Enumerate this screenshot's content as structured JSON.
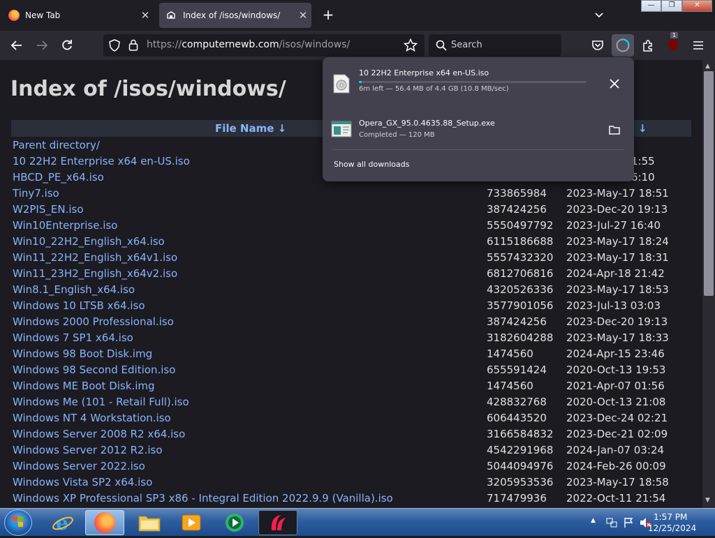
{
  "tabs": [
    {
      "title": "New Tab"
    },
    {
      "title": "Index of /isos/windows/"
    }
  ],
  "navbar": {
    "url_prefix": "https://",
    "url_host": "computernewb.com",
    "url_path": "/isos/windows/",
    "search_placeholder": "Search",
    "extension_badge": "1"
  },
  "page": {
    "title": "Index of /isos/windows/",
    "column_name": "File Name  ↓",
    "column_date_arrow": "↓",
    "parent_link": "Parent directory/",
    "files": [
      {
        "name": "10 22H2 Enterprise x64 en-US.iso",
        "size": "",
        "date": "1:55"
      },
      {
        "name": "HBCD_PE_x64.iso",
        "size": "",
        "date": "6:10"
      },
      {
        "name": "Tiny7.iso",
        "size": "733865984",
        "date": "2023-May-17 18:51"
      },
      {
        "name": "W2PIS_EN.iso",
        "size": "387424256",
        "date": "2023-Dec-20 19:13"
      },
      {
        "name": "Win10Enterprise.iso",
        "size": "5550497792",
        "date": "2023-Jul-27 16:40"
      },
      {
        "name": "Win10_22H2_English_x64.iso",
        "size": "6115186688",
        "date": "2023-May-17 18:24"
      },
      {
        "name": "Win11_22H2_English_x64v1.iso",
        "size": "5557432320",
        "date": "2023-May-17 18:31"
      },
      {
        "name": "Win11_23H2_English_x64v2.iso",
        "size": "6812706816",
        "date": "2024-Apr-18 21:42"
      },
      {
        "name": "Win8.1_English_x64.iso",
        "size": "4320526336",
        "date": "2023-May-17 18:53"
      },
      {
        "name": "Windows 10 LTSB x64.iso",
        "size": "3577901056",
        "date": "2023-Jul-13 03:03"
      },
      {
        "name": "Windows 2000 Professional.iso",
        "size": "387424256",
        "date": "2023-Dec-20 19:13"
      },
      {
        "name": "Windows 7 SP1 x64.iso",
        "size": "3182604288",
        "date": "2023-May-17 18:33"
      },
      {
        "name": "Windows 98 Boot Disk.img",
        "size": "1474560",
        "date": "2024-Apr-15 23:46"
      },
      {
        "name": "Windows 98 Second Edition.iso",
        "size": "655591424",
        "date": "2020-Oct-13 19:53"
      },
      {
        "name": "Windows ME Boot Disk.img",
        "size": "1474560",
        "date": "2021-Apr-07 01:56"
      },
      {
        "name": "Windows Me (101 - Retail Full).iso",
        "size": "428832768",
        "date": "2020-Oct-13 21:08"
      },
      {
        "name": "Windows NT 4 Workstation.iso",
        "size": "606443520",
        "date": "2023-Dec-24 02:21"
      },
      {
        "name": "Windows Server 2008 R2 x64.iso",
        "size": "3166584832",
        "date": "2023-Dec-21 02:09"
      },
      {
        "name": "Windows Server 2012 R2.iso",
        "size": "4542291968",
        "date": "2024-Jan-07 03:24"
      },
      {
        "name": "Windows Server 2022.iso",
        "size": "5044094976",
        "date": "2024-Feb-26 00:09"
      },
      {
        "name": "Windows Vista SP2 x64.iso",
        "size": "3205953536",
        "date": "2023-May-17 18:58"
      },
      {
        "name": "Windows XP Professional SP3 x86 - Integral Edition 2022.9.9 (Vanilla).iso",
        "size": "717479936",
        "date": "2022-Oct-11 21:54"
      }
    ]
  },
  "downloads": {
    "items": [
      {
        "name": "10 22H2 Enterprise x64 en-US.iso",
        "status": "6m left — 56.4 MB of 4.4 GB (10.8 MB/sec)",
        "progress": 0.013
      },
      {
        "name": "Opera_GX_95.0.4635.88_Setup.exe",
        "status": "Completed — 120 MB"
      }
    ],
    "show_all": "Show all downloads"
  },
  "taskbar": {
    "time": "1:57 PM",
    "date": "12/25/2024"
  },
  "colors": {
    "link": "#8ab4f8",
    "progress": "#00ddff",
    "panel": "#42414d"
  }
}
